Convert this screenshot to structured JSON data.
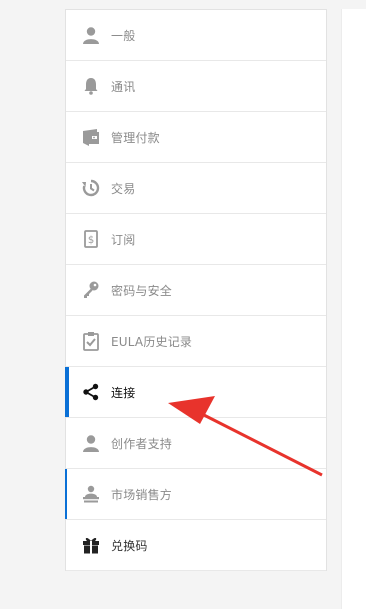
{
  "sidebar": {
    "items": [
      {
        "label": "一般",
        "icon": "user-icon"
      },
      {
        "label": "通讯",
        "icon": "bell-icon"
      },
      {
        "label": "管理付款",
        "icon": "wallet-icon"
      },
      {
        "label": "交易",
        "icon": "history-icon"
      },
      {
        "label": "订阅",
        "icon": "receipt-icon"
      },
      {
        "label": "密码与安全",
        "icon": "key-icon"
      },
      {
        "label": "EULA历史记录",
        "icon": "clipboard-check-icon"
      },
      {
        "label": "连接",
        "icon": "share-icon",
        "active": true
      },
      {
        "label": "创作者支持",
        "icon": "user-icon"
      },
      {
        "label": "市场销售方",
        "icon": "seller-icon"
      },
      {
        "label": "兑换码",
        "icon": "gift-icon"
      }
    ]
  },
  "colors": {
    "accent": "#0a70d6",
    "annotation_arrow": "#e8332c",
    "icon_gray": "#9a9a9a",
    "icon_dark": "#111111"
  }
}
